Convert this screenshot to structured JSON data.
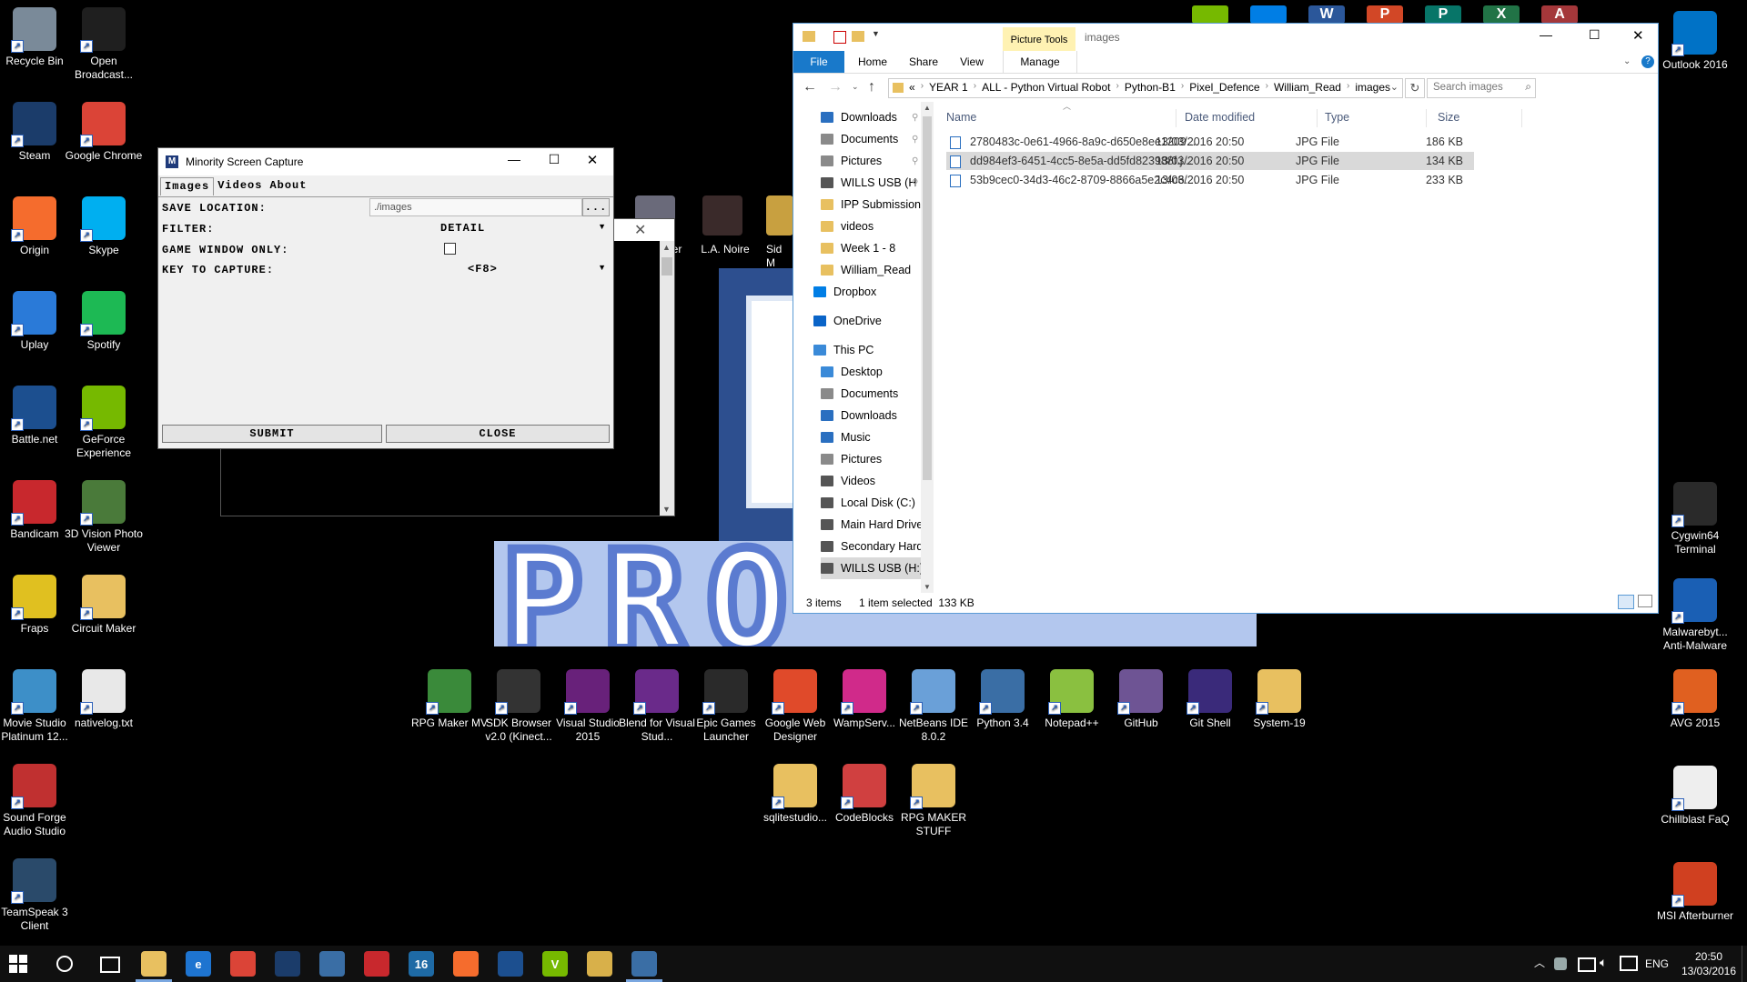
{
  "desktop_left": [
    {
      "label": "Recycle Bin",
      "color": "#7a8a99",
      "icon": "recycle-bin-icon"
    },
    {
      "label": "Open Broadcast...",
      "color": "#1f1f1f",
      "icon": "obs-icon"
    },
    {
      "label": "Steam",
      "color": "#1b3c6a",
      "icon": "steam-icon"
    },
    {
      "label": "Google Chrome",
      "color": "#db4437",
      "icon": "chrome-icon"
    },
    {
      "label": "Origin",
      "color": "#f56c2d",
      "icon": "origin-icon"
    },
    {
      "label": "Skype",
      "color": "#00aff0",
      "icon": "skype-icon"
    },
    {
      "label": "Uplay",
      "color": "#2a7ad8",
      "icon": "uplay-icon"
    },
    {
      "label": "Spotify",
      "color": "#1db954",
      "icon": "spotify-icon"
    },
    {
      "label": "Battle.net",
      "color": "#1c4f8f",
      "icon": "battlenet-icon"
    },
    {
      "label": "GeForce Experience",
      "color": "#76b900",
      "icon": "geforce-icon"
    },
    {
      "label": "Bandicam",
      "color": "#c8282d",
      "icon": "bandicam-icon"
    },
    {
      "label": "3D Vision Photo Viewer",
      "color": "#4a7a3a",
      "icon": "3dvision-icon"
    },
    {
      "label": "Fraps",
      "color": "#e0c020",
      "icon": "fraps-icon"
    },
    {
      "label": "Circuit Maker",
      "color": "#e8c060",
      "icon": "folder-icon"
    },
    {
      "label": "Movie Studio Platinum 12...",
      "color": "#3d8fc8",
      "icon": "movie-studio-icon"
    },
    {
      "label": "nativelog.txt",
      "color": "#e8e8e8",
      "icon": "text-file-icon"
    },
    {
      "label": "Sound Forge Audio Studio",
      "color": "#c03030",
      "icon": "sound-forge-icon"
    },
    {
      "label": "",
      "color": "#000000",
      "icon": "blank"
    },
    {
      "label": "TeamSpeak 3 Client",
      "color": "#2a4a6a",
      "icon": "teamspeak-icon"
    }
  ],
  "desktop_right": [
    {
      "label": "Outlook 2016",
      "color": "#0072c6",
      "icon": "outlook-icon"
    },
    {
      "label": "Cygwin64 Terminal",
      "color": "#2a2a2a",
      "icon": "cygwin-icon"
    },
    {
      "label": "Malwarebyt... Anti-Malware",
      "color": "#1a5fb4",
      "icon": "malwarebytes-icon"
    },
    {
      "label": "AVG 2015",
      "color": "#e06020",
      "icon": "avg-icon"
    },
    {
      "label": "Chillblast FaQ",
      "color": "#eeeeee",
      "icon": "chillblast-icon"
    },
    {
      "label": "MSI Afterburner",
      "color": "#d04020",
      "icon": "msi-icon"
    }
  ],
  "desktop_middle_row1": [
    {
      "label": "RPG Maker MV",
      "color": "#3a8a3a",
      "icon": "rpg-maker-icon"
    },
    {
      "label": "SDK Browser v2.0 (Kinect...",
      "color": "#333333",
      "icon": "kinect-icon"
    },
    {
      "label": "Visual Studio 2015",
      "color": "#68217a",
      "icon": "visual-studio-icon"
    },
    {
      "label": "Blend for Visual Stud...",
      "color": "#6a2a8a",
      "icon": "blend-icon"
    },
    {
      "label": "Epic Games Launcher",
      "color": "#2a2a2a",
      "icon": "epic-games-icon"
    },
    {
      "label": "Google Web Designer",
      "color": "#e04a2a",
      "icon": "web-designer-icon"
    },
    {
      "label": "WampServ...",
      "color": "#d02a8a",
      "icon": "wamp-icon"
    },
    {
      "label": "NetBeans IDE 8.0.2",
      "color": "#6aa0d8",
      "icon": "netbeans-icon"
    },
    {
      "label": "Python 3.4",
      "color": "#3a6ea5",
      "icon": "python-icon"
    },
    {
      "label": "Notepad++",
      "color": "#8ac040",
      "icon": "notepadpp-icon"
    },
    {
      "label": "GitHub",
      "color": "#6e5494",
      "icon": "github-icon"
    },
    {
      "label": "Git Shell",
      "color": "#3a2a7a",
      "icon": "git-shell-icon"
    },
    {
      "label": "System-19",
      "color": "#e8c060",
      "icon": "folder-icon"
    }
  ],
  "desktop_middle_row2": [
    {
      "label": "sqlitestudio...",
      "color": "#e8c060",
      "icon": "folder-icon"
    },
    {
      "label": "CodeBlocks",
      "color": "#d04040",
      "icon": "codeblocks-icon"
    },
    {
      "label": "RPG MAKER STUFF",
      "color": "#e8c060",
      "icon": "folder-icon"
    }
  ],
  "partial_icons": [
    {
      "label": "L.A. Noire",
      "icon": "la-noire-icon"
    },
    {
      "label": "Sid M Civiliz",
      "icon": "civilization-icon"
    },
    {
      "label": "e der",
      "icon": "partial-icon"
    }
  ],
  "background_text": "PRO",
  "capture_window": {
    "title": "Minority Screen Capture",
    "tabs": [
      "Images",
      "Videos",
      "About"
    ],
    "save_location_label": "SAVE LOCATION:",
    "save_location_value": "./images",
    "browse_label": "...",
    "filter_label": "FILTER:",
    "filter_value": "DETAIL",
    "game_window_label": "GAME WINDOW ONLY:",
    "key_label": "KEY TO CAPTURE:",
    "key_value": "<F8>",
    "submit_label": "SUBMIT",
    "close_label": "CLOSE"
  },
  "explorer": {
    "title": "images",
    "context_tab": "Picture Tools",
    "ribbon_tabs": [
      "File",
      "Home",
      "Share",
      "View",
      "Manage"
    ],
    "breadcrumb": [
      "«",
      "YEAR 1",
      "ALL - Python Virtual Robot",
      "Python-B1",
      "Pixel_Defence",
      "William_Read",
      "images"
    ],
    "search_placeholder": "Search images",
    "nav": [
      {
        "label": "Downloads",
        "color": "#2a6fc0",
        "pinned": true
      },
      {
        "label": "Documents",
        "color": "#8a8a8a",
        "pinned": true
      },
      {
        "label": "Pictures",
        "color": "#8a8a8a",
        "pinned": true
      },
      {
        "label": "WILLS USB (H",
        "color": "#555555",
        "pinned": true
      },
      {
        "label": "IPP Submission",
        "color": "#e8c060",
        "pinned": false
      },
      {
        "label": "videos",
        "color": "#e8c060",
        "pinned": false
      },
      {
        "label": "Week 1 - 8",
        "color": "#e8c060",
        "pinned": false
      },
      {
        "label": "William_Read",
        "color": "#e8c060",
        "pinned": false
      }
    ],
    "nav_top": [
      {
        "label": "Dropbox",
        "color": "#007ee5"
      },
      {
        "label": "OneDrive",
        "color": "#0a64c8"
      },
      {
        "label": "This PC",
        "color": "#3a8ad8"
      }
    ],
    "nav_pc": [
      {
        "label": "Desktop",
        "color": "#3a8ad8"
      },
      {
        "label": "Documents",
        "color": "#8a8a8a"
      },
      {
        "label": "Downloads",
        "color": "#2a6fc0"
      },
      {
        "label": "Music",
        "color": "#2a6fc0"
      },
      {
        "label": "Pictures",
        "color": "#8a8a8a"
      },
      {
        "label": "Videos",
        "color": "#555555"
      },
      {
        "label": "Local Disk (C:)",
        "color": "#555555"
      },
      {
        "label": "Main Hard Drive",
        "color": "#555555"
      },
      {
        "label": "Secondary Hard",
        "color": "#555555"
      },
      {
        "label": "WILLS USB (H:)",
        "color": "#555555"
      }
    ],
    "columns": [
      "Name",
      "Date modified",
      "Type",
      "Size"
    ],
    "files": [
      {
        "name": "2780483c-0e61-4966-8a9c-d650e8ee1209....",
        "date": "13/03/2016 20:50",
        "type": "JPG File",
        "size": "186 KB",
        "selected": false
      },
      {
        "name": "dd984ef3-6451-4cc5-8e5a-dd5fd823988f.j...",
        "date": "13/03/2016 20:50",
        "type": "JPG File",
        "size": "134 KB",
        "selected": true
      },
      {
        "name": "53b9cec0-34d3-46c2-8709-8866a5e2c4c6....",
        "date": "13/03/2016 20:50",
        "type": "JPG File",
        "size": "233 KB",
        "selected": false
      }
    ],
    "status_items": "3 items",
    "status_selected": "1 item selected  133 KB"
  },
  "taskbar": {
    "language": "ENG",
    "time": "20:50",
    "date": "13/03/2016",
    "pinned": [
      {
        "icon": "file-explorer-icon",
        "color": "#e8c060",
        "text": ""
      },
      {
        "icon": "edge-icon",
        "color": "#1e74d0",
        "text": "e"
      },
      {
        "icon": "chrome-icon",
        "color": "#db4437",
        "text": ""
      },
      {
        "icon": "steam-icon",
        "color": "#1b3c6a",
        "text": ""
      },
      {
        "icon": "app-icon",
        "color": "#3a6ea5",
        "text": ""
      },
      {
        "icon": "bandicam-icon",
        "color": "#c8282d",
        "text": ""
      },
      {
        "icon": "app-16-icon",
        "color": "#1e6aa5",
        "text": "16"
      },
      {
        "icon": "origin-icon",
        "color": "#f56c2d",
        "text": ""
      },
      {
        "icon": "battlenet-icon",
        "color": "#1c4f8f",
        "text": ""
      },
      {
        "icon": "vectorworks-icon",
        "color": "#76b900",
        "text": "V"
      },
      {
        "icon": "python-idle-icon",
        "color": "#d8b04a",
        "text": ""
      },
      {
        "icon": "python-app-icon",
        "color": "#3a6ea5",
        "text": ""
      }
    ]
  },
  "top_right_apps": [
    {
      "icon": "app-green-icon",
      "color": "#76b900",
      "text": ""
    },
    {
      "icon": "dropbox-icon",
      "color": "#007ee5",
      "text": ""
    },
    {
      "icon": "word-icon",
      "color": "#2b579a",
      "text": "W"
    },
    {
      "icon": "powerpoint-icon",
      "color": "#d24726",
      "text": "P"
    },
    {
      "icon": "publisher-icon",
      "color": "#077568",
      "text": "P"
    },
    {
      "icon": "excel-icon",
      "color": "#217346",
      "text": "X"
    },
    {
      "icon": "access-icon",
      "color": "#a4373a",
      "text": "A"
    }
  ]
}
